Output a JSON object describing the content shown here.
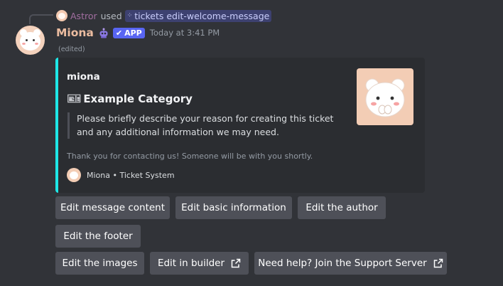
{
  "reply": {
    "user": "Astror",
    "used_text": "used",
    "command": "tickets edit-welcome-message"
  },
  "message": {
    "username": "Miona",
    "badge": "APP",
    "timestamp": "Today at 3:41 PM",
    "edited": "(edited)"
  },
  "embed": {
    "accent_color": "#1ee6e6",
    "author": "miona",
    "title": "Example Category",
    "description": "Please briefly describe your reason for creating this ticket and any additional information we may need.",
    "footer_text": "Thank you for contacting us! Someone will be with you shortly.",
    "footer_label": "Miona • Ticket System"
  },
  "buttons": {
    "edit_message_content": "Edit message content",
    "edit_basic_information": "Edit basic information",
    "edit_author": "Edit the author",
    "edit_footer": "Edit the footer",
    "edit_images": "Edit the images",
    "edit_in_builder": "Edit in builder",
    "support_server": "Need help? Join the Support Server"
  },
  "icons": {
    "command": "apps-icon",
    "ticket": "ticket-icon",
    "external_link": "external-link-icon",
    "verified": "checkmark-icon"
  }
}
